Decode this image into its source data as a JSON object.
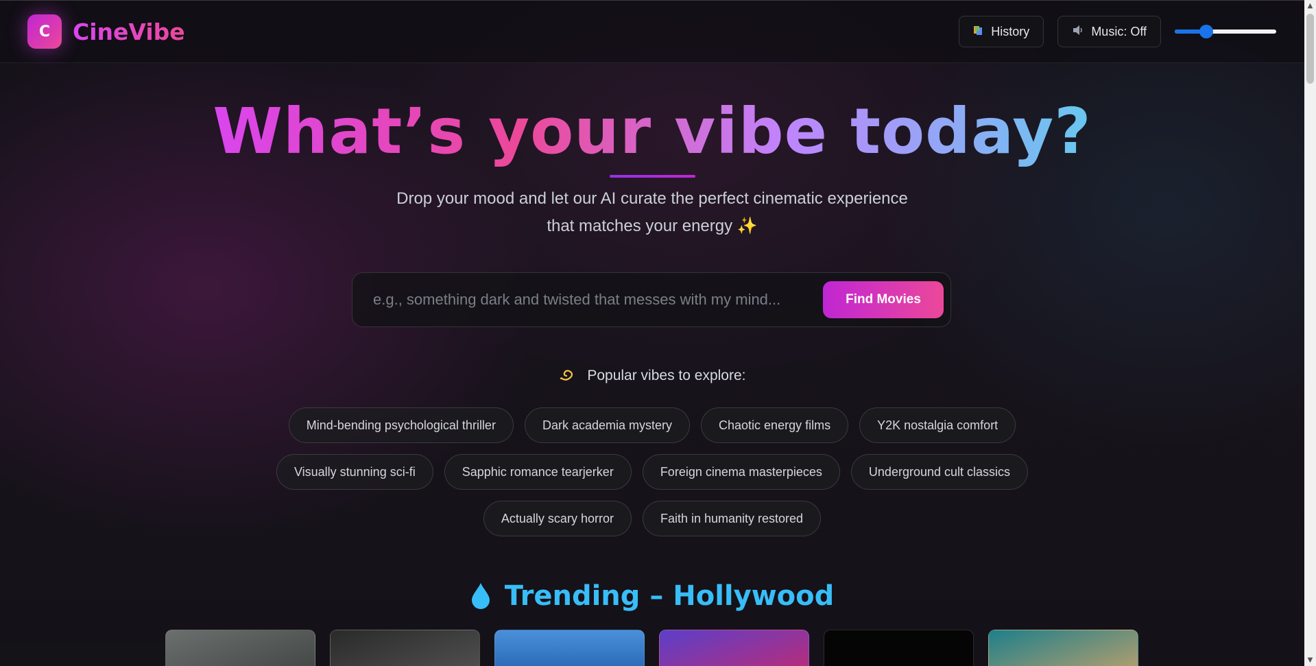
{
  "header": {
    "logo_letter": "C",
    "brand": "CineVibe",
    "history_label": "History",
    "music_label": "Music: Off",
    "volume_level": 0.28
  },
  "hero": {
    "title": "What’s your vibe today?",
    "subtitle": "Drop your mood and let our AI curate the perfect cinematic experience that matches your energy ✨"
  },
  "search": {
    "placeholder": "e.g., something dark and twisted that messes with my mind...",
    "value": "",
    "button_label": "Find Movies"
  },
  "popular": {
    "heading": "Popular vibes to explore:",
    "chips": [
      "Mind-bending psychological thriller",
      "Dark academia mystery",
      "Chaotic energy films",
      "Y2K nostalgia comfort",
      "Visually stunning sci-fi",
      "Sapphic romance tearjerker",
      "Foreign cinema masterpieces",
      "Underground cult classics",
      "Actually scary horror",
      "Faith in humanity restored"
    ]
  },
  "trending": {
    "title": "Trending – Hollywood",
    "icon": "droplet-icon"
  },
  "colors": {
    "accent": "#d946ef",
    "accent2": "#ec4899",
    "trending": "#38bdf8"
  }
}
